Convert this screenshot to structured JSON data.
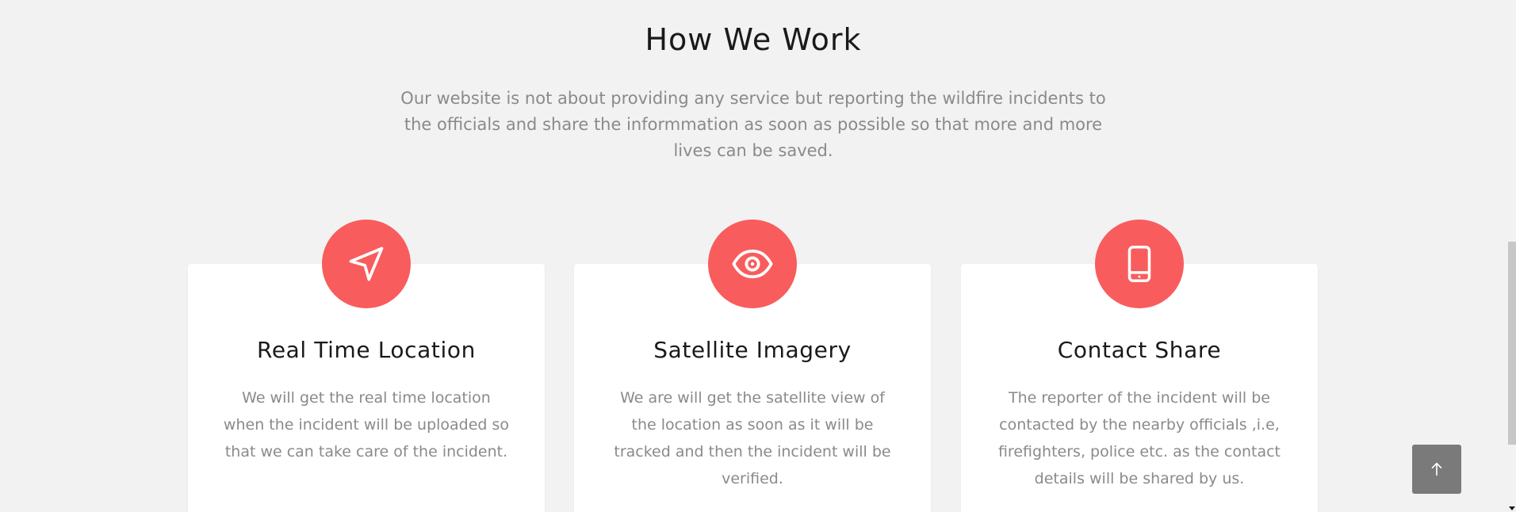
{
  "section": {
    "title": "How We Work",
    "intro": "Our website is not about providing any service but reporting the wildfire incidents to the officials and share the informmation as soon as possible so that more and more lives can be saved."
  },
  "cards": [
    {
      "icon": "navigation-arrow-icon",
      "title": "Real Time Location",
      "text": "We will get the real time location when the incident will be uploaded so that we can take care of the incident."
    },
    {
      "icon": "eye-icon",
      "title": "Satellite Imagery",
      "text": "We are will get the satellite view of the location as soon as it will be tracked and then the incident will be verified."
    },
    {
      "icon": "mobile-phone-icon",
      "title": "Contact Share",
      "text": "The reporter of the incident will be contacted by the nearby officials ,i.e, firefighters, police etc. as the contact details will be shared by us."
    }
  ],
  "back_to_top": {
    "icon": "arrow-up-icon"
  },
  "colors": {
    "accent": "#f95c5c",
    "background": "#f2f2f2",
    "card": "#ffffff",
    "heading": "#1a1a1a",
    "body_text": "#8a8a8a",
    "back_to_top": "#7a7a7a"
  }
}
